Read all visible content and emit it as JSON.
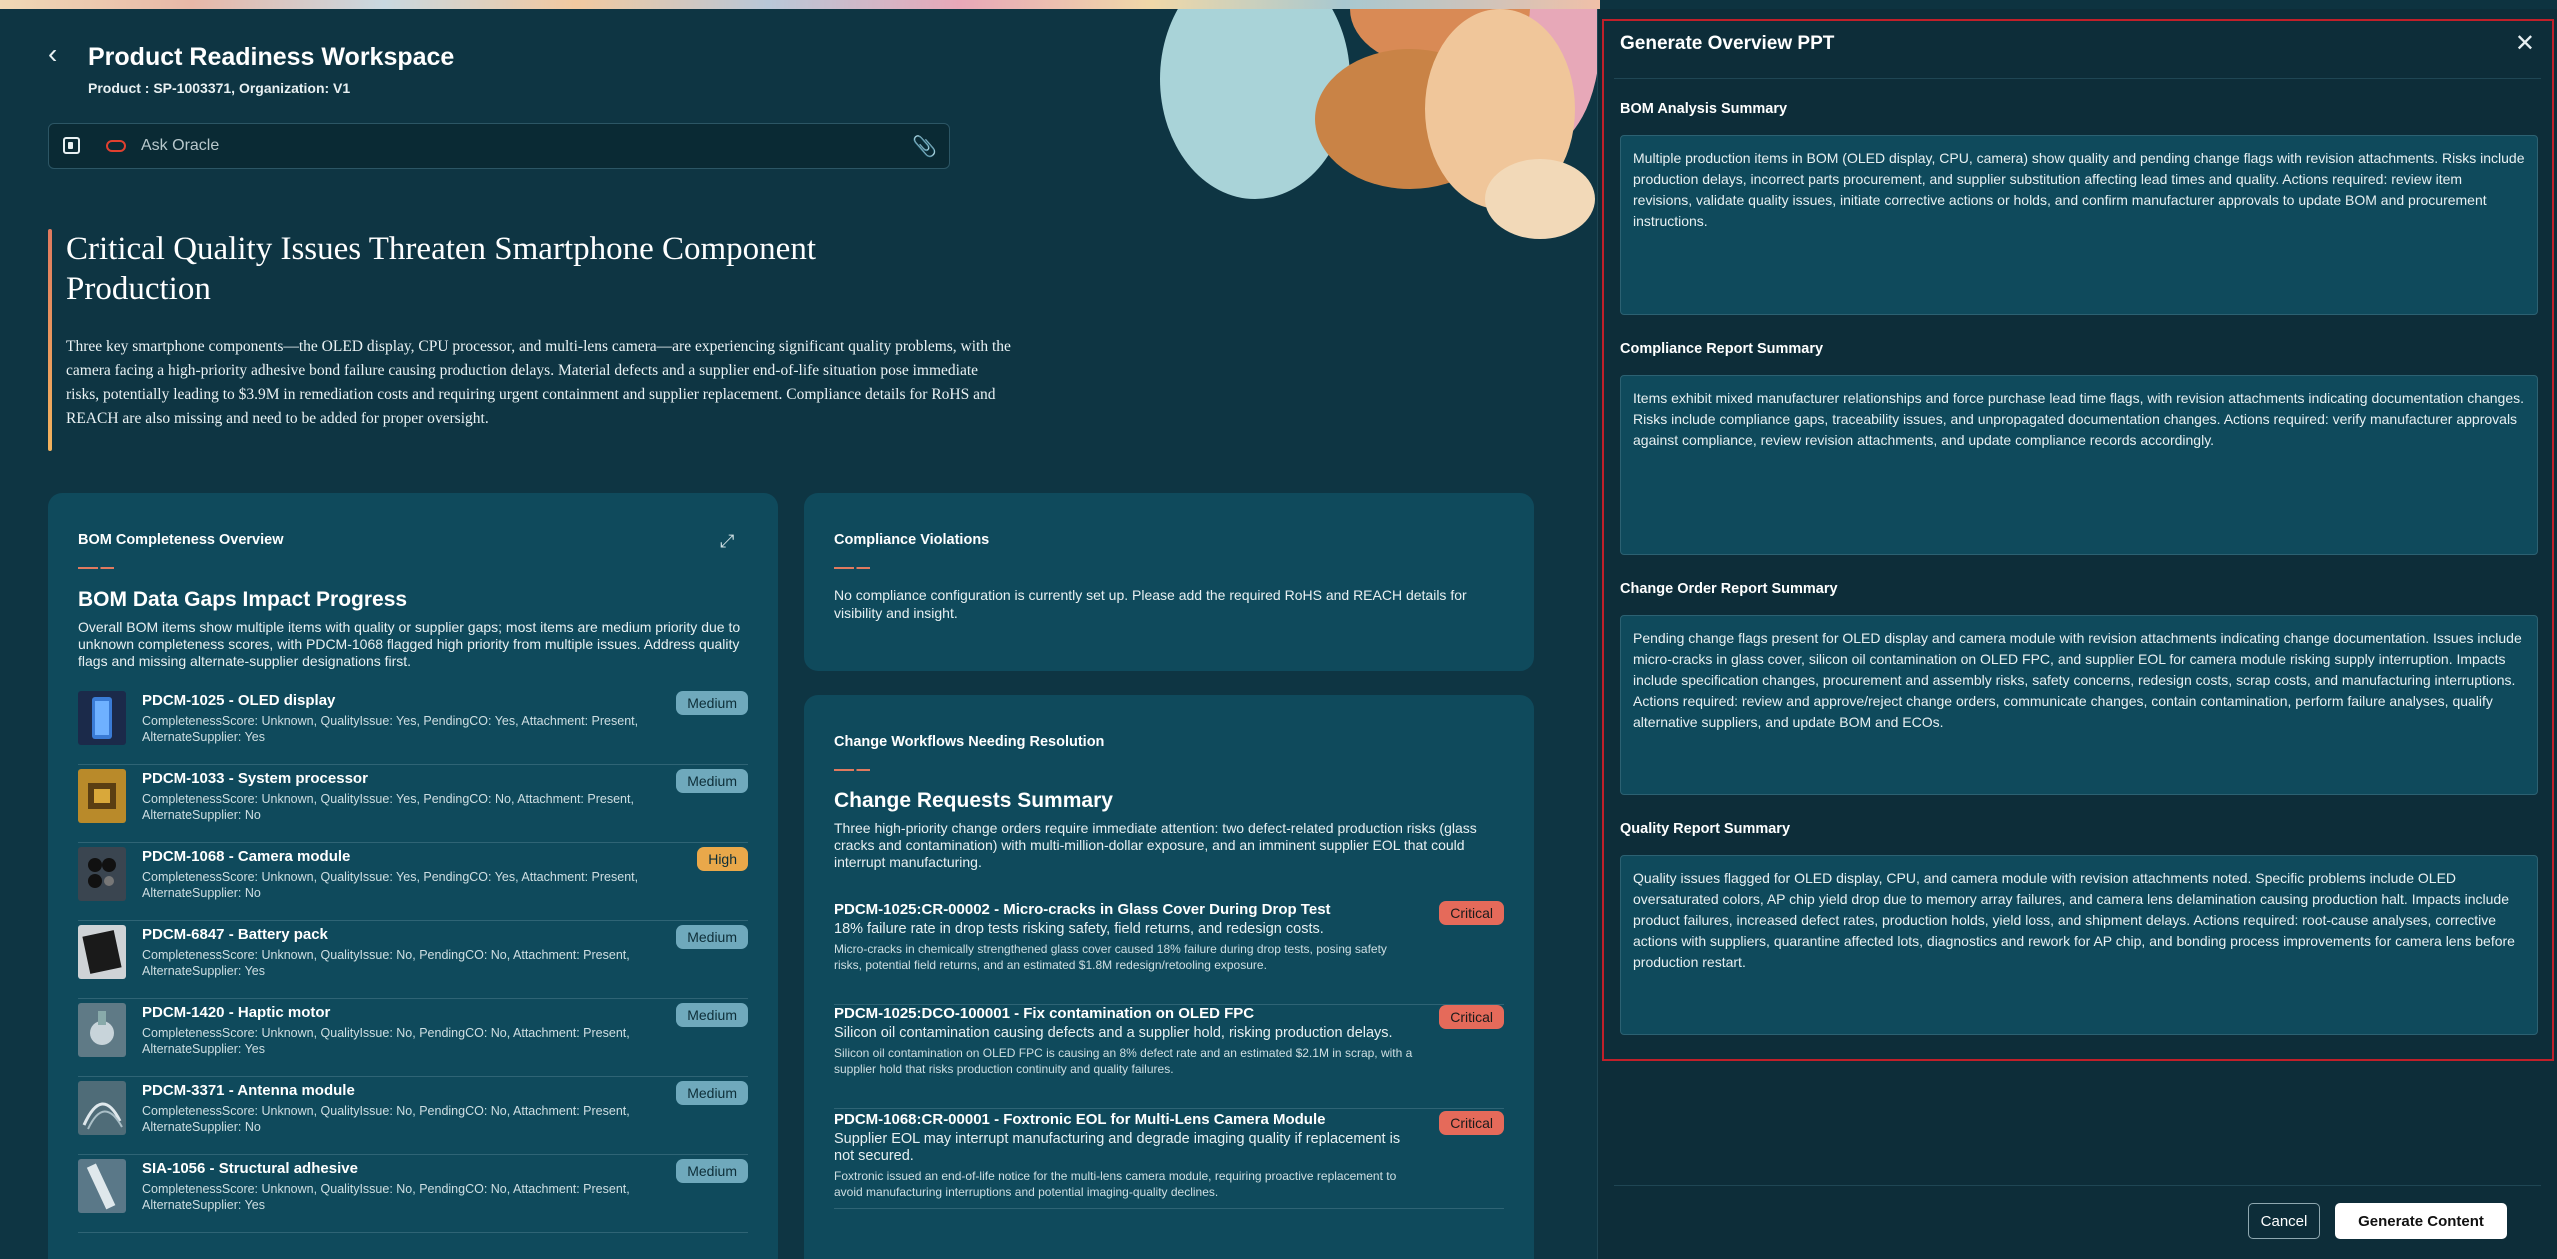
{
  "header": {
    "title": "Product Readiness Workspace",
    "subtitle": "Product : SP-1003371, Organization: V1"
  },
  "ask_bar": {
    "placeholder": "Ask Oracle"
  },
  "hero": {
    "title": "Critical Quality Issues Threaten Smartphone Component Production",
    "body": "Three key smartphone components—the OLED display, CPU processor, and multi-lens camera—are experiencing significant quality problems, with the camera facing a high-priority adhesive bond failure causing production delays. Material defects and a supplier end-of-life situation pose immediate risks, potentially leading to $3.9M in remediation costs and requiring urgent containment and supplier replacement. Compliance details for RoHS and REACH are also missing and need to be added for proper oversight."
  },
  "bom": {
    "card_title": "BOM Completeness Overview",
    "big_title": "BOM Data Gaps Impact Progress",
    "description": "Overall BOM items show multiple items with quality or supplier gaps; most items are medium priority due to unknown completeness scores, with PDCM-1068 flagged high priority from multiple issues. Address quality flags and missing alternate-supplier designations first.",
    "items": [
      {
        "name": "PDCM-1025 - OLED display",
        "meta": "CompletenessScore: Unknown, QualityIssue: Yes, PendingCO: Yes, Attachment: Present, AlternateSupplier: Yes",
        "priority": "Medium"
      },
      {
        "name": "PDCM-1033 - System processor",
        "meta": "CompletenessScore: Unknown, QualityIssue: Yes, PendingCO: No, Attachment: Present, AlternateSupplier: No",
        "priority": "Medium"
      },
      {
        "name": "PDCM-1068 - Camera module",
        "meta": "CompletenessScore: Unknown, QualityIssue: Yes, PendingCO: Yes, Attachment: Present, AlternateSupplier: No",
        "priority": "High"
      },
      {
        "name": "PDCM-6847 - Battery pack",
        "meta": "CompletenessScore: Unknown, QualityIssue: No, PendingCO: No, Attachment: Present, AlternateSupplier: Yes",
        "priority": "Medium"
      },
      {
        "name": "PDCM-1420 - Haptic motor",
        "meta": "CompletenessScore: Unknown, QualityIssue: No, PendingCO: No, Attachment: Present, AlternateSupplier: Yes",
        "priority": "Medium"
      },
      {
        "name": "PDCM-3371 - Antenna module",
        "meta": "CompletenessScore: Unknown, QualityIssue: No, PendingCO: No, Attachment: Present, AlternateSupplier: No",
        "priority": "Medium"
      },
      {
        "name": "SIA-1056 - Structural adhesive",
        "meta": "CompletenessScore: Unknown, QualityIssue: No, PendingCO: No, Attachment: Present, AlternateSupplier: Yes",
        "priority": "Medium"
      }
    ]
  },
  "compliance": {
    "card_title": "Compliance Violations",
    "description": "No compliance configuration is currently set up. Please add the required RoHS and REACH details for visibility and insight."
  },
  "change": {
    "card_title": "Change Workflows Needing Resolution",
    "big_title": "Change Requests Summary",
    "description": "Three high-priority change orders require immediate attention: two defect-related production risks (glass cracks and contamination) with multi-million-dollar exposure, and an imminent supplier EOL that could interrupt manufacturing.",
    "items": [
      {
        "name": "PDCM-1025:CR-00002 - Micro-cracks in Glass Cover During Drop Test",
        "summary": "18% failure rate in drop tests risking safety, field returns, and redesign costs.",
        "detail": "Micro-cracks in chemically strengthened glass cover caused 18% failure during drop tests, posing safety risks, potential field returns, and an estimated $1.8M redesign/retooling exposure.",
        "priority": "Critical"
      },
      {
        "name": "PDCM-1025:DCO-100001 - Fix contamination on OLED FPC",
        "summary": "Silicon oil contamination causing defects and a supplier hold, risking production delays.",
        "detail": "Silicon oil contamination on OLED FPC is causing an 8% defect rate and an estimated $2.1M in scrap, with a supplier hold that risks production continuity and quality failures.",
        "priority": "Critical"
      },
      {
        "name": "PDCM-1068:CR-00001 - Foxtronic EOL for Multi-Lens Camera Module",
        "summary": "Supplier EOL may interrupt manufacturing and degrade imaging quality if replacement is not secured.",
        "detail": "Foxtronic issued an end-of-life notice for the multi-lens camera module, requiring proactive replacement to avoid manufacturing interruptions and potential imaging-quality declines.",
        "priority": "Critical"
      }
    ]
  },
  "panel": {
    "title": "Generate Overview PPT",
    "sections": [
      {
        "label": "BOM Analysis Summary",
        "text": "Multiple production items in BOM (OLED display, CPU, camera) show quality and pending change flags with revision attachments. Risks include production delays, incorrect parts procurement, and supplier substitution affecting lead times and quality. Actions required: review item revisions, validate quality issues, initiate corrective actions or holds, and confirm manufacturer approvals to update BOM and procurement instructions."
      },
      {
        "label": "Compliance Report Summary",
        "text": "Items exhibit mixed manufacturer relationships and force purchase lead time flags, with revision attachments indicating documentation changes. Risks include compliance gaps, traceability issues, and unpropagated documentation changes. Actions required: verify manufacturer approvals against compliance, review revision attachments, and update compliance records accordingly."
      },
      {
        "label": "Change Order Report Summary",
        "text": "Pending change flags present for OLED display and camera module with revision attachments indicating change documentation. Issues include micro-cracks in glass cover, silicon oil contamination on OLED FPC, and supplier EOL for camera module risking supply interruption. Impacts include specification changes, procurement and assembly risks, safety concerns, redesign costs, scrap costs, and manufacturing interruptions. Actions required: review and approve/reject change orders, communicate changes, contain contamination, perform failure analyses, qualify alternative suppliers, and update BOM and ECOs."
      },
      {
        "label": "Quality Report Summary",
        "text": "Quality issues flagged for OLED display, CPU, and camera module with revision attachments noted. Specific problems include OLED oversaturated colors, AP chip yield drop due to memory array failures, and camera lens delamination causing production halt. Impacts include product failures, increased defect rates, production holds, yield loss, and shipment delays. Actions required: root-cause analyses, corrective actions with suppliers, quarantine affected lots, diagnostics and rework for AP chip, and bonding process improvements for camera lens before production restart."
      }
    ],
    "cancel_label": "Cancel",
    "generate_label": "Generate Content"
  },
  "icons": {
    "back": "chevron-left-icon",
    "close": "close-icon",
    "expand": "expand-icon",
    "attach": "paperclip-icon"
  },
  "colors": {
    "background": "#0e3543",
    "card": "#0f4a5c",
    "medium_badge": "#6fa9bc",
    "high_badge": "#e9a84a",
    "critical_badge": "#e56a5a",
    "panel_highlight": "#c0202a"
  }
}
